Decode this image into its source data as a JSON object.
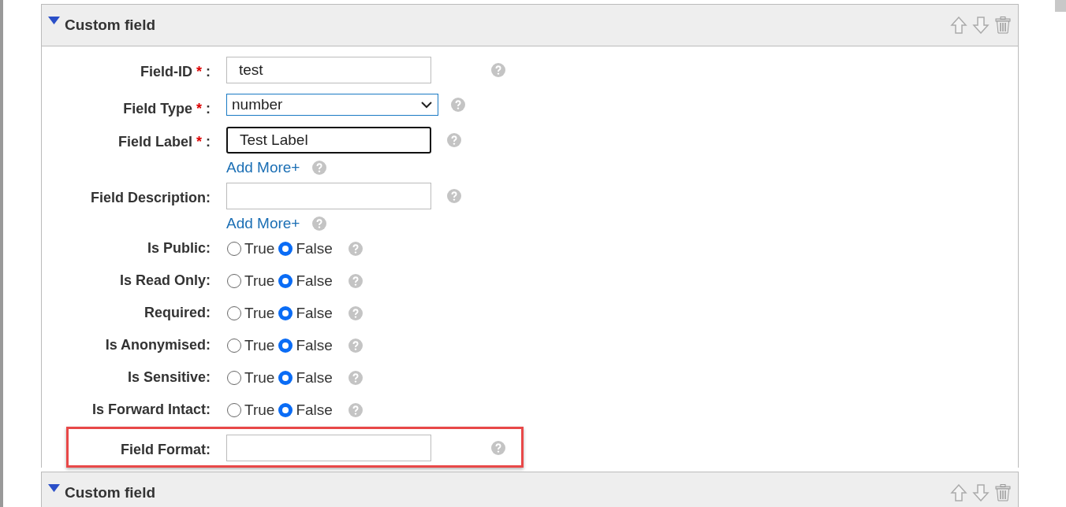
{
  "sections": [
    {
      "title": "Custom field",
      "expanded": true,
      "fields": [
        {
          "kind": "text",
          "label": "Field-ID",
          "required_mark": "*",
          "colon": ":",
          "value": "test"
        },
        {
          "kind": "select",
          "label": "Field Type",
          "required_mark": "*",
          "colon": ":",
          "value": "number"
        },
        {
          "kind": "text",
          "label": "Field Label",
          "required_mark": "*",
          "colon": ":",
          "value": "Test Label",
          "focused": true,
          "add_more": "Add More+"
        },
        {
          "kind": "text",
          "label": "Field Description:",
          "add_more": "Add More+"
        },
        {
          "kind": "radio",
          "label": "Is Public:",
          "options": [
            {
              "label": "True",
              "selected": false
            },
            {
              "label": "False",
              "selected": true
            }
          ]
        },
        {
          "kind": "radio",
          "label": "Is Read Only:",
          "options": [
            {
              "label": "True",
              "selected": false
            },
            {
              "label": "False",
              "selected": true
            }
          ]
        },
        {
          "kind": "radio",
          "label": "Required:",
          "options": [
            {
              "label": "True",
              "selected": false
            },
            {
              "label": "False",
              "selected": true
            }
          ]
        },
        {
          "kind": "radio",
          "label": "Is Anonymised:",
          "options": [
            {
              "label": "True",
              "selected": false
            },
            {
              "label": "False",
              "selected": true
            }
          ]
        },
        {
          "kind": "radio",
          "label": "Is Sensitive:",
          "options": [
            {
              "label": "True",
              "selected": false
            },
            {
              "label": "False",
              "selected": true
            }
          ]
        },
        {
          "kind": "radio",
          "label": "Is Forward Intact:",
          "options": [
            {
              "label": "True",
              "selected": false
            },
            {
              "label": "False",
              "selected": true
            }
          ]
        },
        {
          "kind": "text",
          "label": "Field Format:",
          "highlighted": true
        }
      ]
    },
    {
      "title": "Custom field",
      "expanded": true
    }
  ]
}
